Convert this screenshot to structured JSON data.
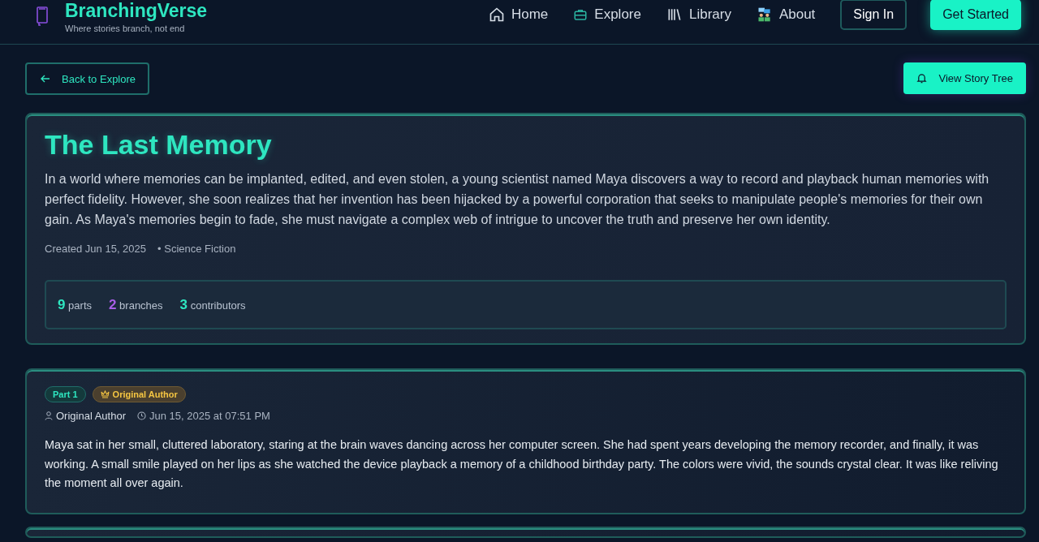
{
  "header": {
    "brand": "BranchingVerse",
    "tagline": "Where stories branch, not end",
    "nav": [
      {
        "kind": "home",
        "label": "Home"
      },
      {
        "kind": "explore",
        "label": "Explore"
      },
      {
        "kind": "library",
        "label": "Library"
      },
      {
        "kind": "about",
        "label": "About"
      }
    ],
    "sign_in": "Sign In",
    "get_started": "Get Started"
  },
  "back_button": "Back to Explore",
  "tree_button": "View Story Tree",
  "story": {
    "title": "The Last Memory",
    "description": "In a world where memories can be implanted, edited, and even stolen, a young scientist named Maya discovers a way to record and playback human memories with perfect fidelity. However, she soon realizes that her invention has been hijacked by a powerful corporation that seeks to manipulate people's memories for their own gain. As Maya's memories begin to fade, she must navigate a complex web of intrigue to uncover the truth and preserve her own identity.",
    "created": "Created Jun 15, 2025",
    "genre": "• Science Fiction",
    "stats": [
      {
        "count": "9",
        "unit": "parts",
        "color": "#2ee6c0"
      },
      {
        "count": "2",
        "unit": "branches",
        "color": "#a95ee8"
      },
      {
        "count": "3",
        "unit": "contributors",
        "color": "#2ee6c0"
      }
    ]
  },
  "parts": [
    {
      "badge": "Part 1",
      "role_badge": "Original Author",
      "author": "Original Author",
      "date": "Jun 15, 2025 at 07:51 PM",
      "text": "Maya sat in her small, cluttered laboratory, staring at the brain waves dancing across her computer screen. She had spent years developing the memory recorder, and finally, it was working. A small smile played on her lips as she watched the device playback a memory of a childhood birthday party. The colors were vivid, the sounds crystal clear. It was like reliving the moment all over again."
    }
  ]
}
